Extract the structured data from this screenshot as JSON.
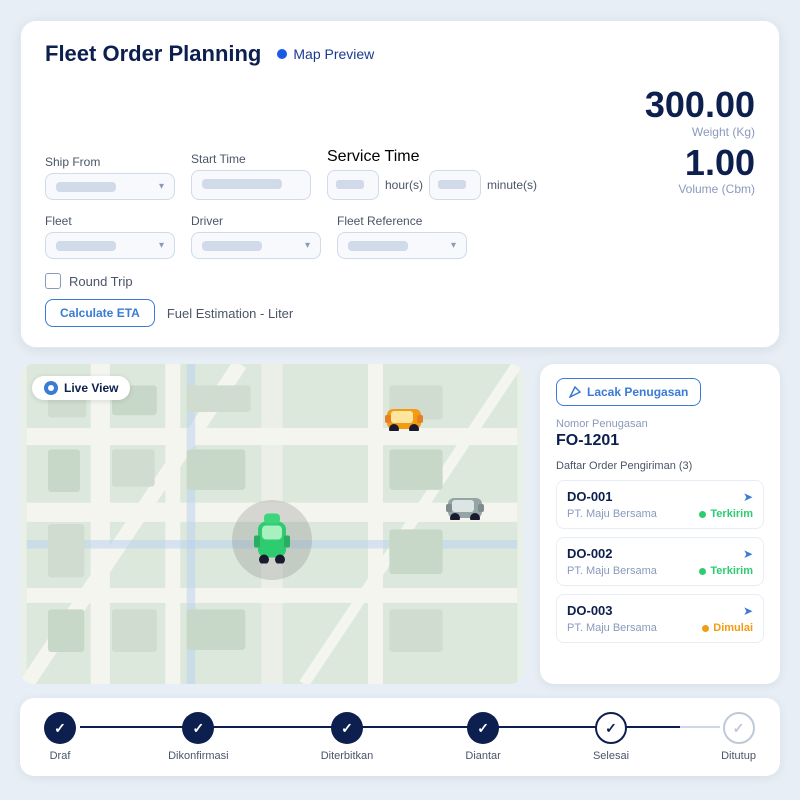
{
  "header": {
    "title": "Fleet Order Planning",
    "map_preview": "Map Preview"
  },
  "form": {
    "ship_from_label": "Ship From",
    "start_time_label": "Start Time",
    "service_time_label": "Service Time",
    "fleet_label": "Fleet",
    "driver_label": "Driver",
    "fleet_reference_label": "Fleet Reference",
    "hours_unit": "hour(s)",
    "minutes_unit": "minute(s)",
    "round_trip_label": "Round Trip",
    "calculate_eta_label": "Calculate ETA",
    "fuel_estimation_label": "Fuel Estimation - Liter"
  },
  "metrics": {
    "weight_value": "300.00",
    "weight_label": "Weight (Kg)",
    "volume_value": "1.00",
    "volume_label": "Volume (Cbm)"
  },
  "map": {
    "live_view_label": "Live View"
  },
  "right_panel": {
    "lacak_btn": "Lacak Penugasan",
    "nomor_label": "Nomor Penugasan",
    "fo_number": "FO-1201",
    "daftar_label": "Daftar Order Pengiriman (3)",
    "orders": [
      {
        "id": "DO-001",
        "company": "PT. Maju Bersama",
        "status": "Terkirim",
        "type": "terkirim"
      },
      {
        "id": "DO-002",
        "company": "PT. Maju Bersama",
        "status": "Terkirim",
        "type": "terkirim"
      },
      {
        "id": "DO-003",
        "company": "PT. Maju Bersama",
        "status": "Dimulai",
        "type": "dimulai"
      }
    ]
  },
  "timeline": {
    "steps": [
      {
        "label": "Draf",
        "filled": true
      },
      {
        "label": "Dikonfirmasi",
        "filled": true
      },
      {
        "label": "Diterbitkan",
        "filled": true
      },
      {
        "label": "Diantar",
        "filled": true
      },
      {
        "label": "Selesai",
        "filled": true,
        "outline": true
      },
      {
        "label": "Ditutup",
        "filled": false
      }
    ]
  }
}
